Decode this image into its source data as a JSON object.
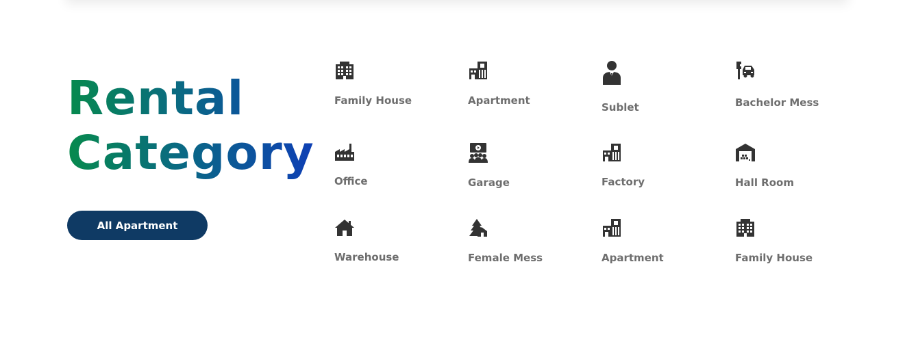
{
  "heading": {
    "line1": "Rental",
    "line2": "Category"
  },
  "cta": {
    "label": "All Apartment"
  },
  "colors": {
    "gradient_start": "#078a4d",
    "gradient_end": "#0e3fb5",
    "button": "#0f3a64",
    "label_text": "#6e6e6e",
    "icon": "#333333"
  },
  "categories": [
    {
      "label": "Family House",
      "icon": "office-building-icon"
    },
    {
      "label": "Apartment",
      "icon": "apartment-building-icon"
    },
    {
      "label": "Sublet",
      "icon": "person-suit-icon"
    },
    {
      "label": "Bachelor Mess",
      "icon": "wrench-car-icon"
    },
    {
      "label": "Office",
      "icon": "factory-icon"
    },
    {
      "label": "Garage",
      "icon": "presentation-audience-icon"
    },
    {
      "label": "Factory",
      "icon": "apartment-building-icon"
    },
    {
      "label": "Hall Room",
      "icon": "warehouse-icon"
    },
    {
      "label": "Warehouse",
      "icon": "home-icon"
    },
    {
      "label": "Female Mess",
      "icon": "forest-cabin-icon"
    },
    {
      "label": "Apartment",
      "icon": "apartment-building-icon"
    },
    {
      "label": "Family House",
      "icon": "office-building-icon"
    }
  ]
}
